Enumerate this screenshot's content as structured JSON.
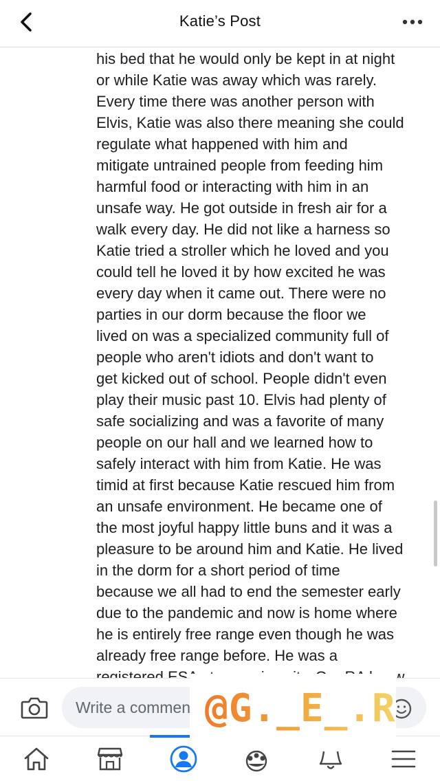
{
  "header": {
    "title": "Katie’s Post"
  },
  "post": {
    "lines": [
      "his bed that he would only be kept in at night",
      "or while Katie was away which was rarely.",
      "Every time there was another person with",
      "Elvis, Katie was also there meaning she could",
      "regulate what happened with him and",
      "mitigate untrained people from feeding him",
      "harmful food or interacting with him in an",
      "unsafe way. He got outside in fresh air for a",
      "walk every day. He did not like a harness so",
      "Katie tried a stroller which he loved and you",
      "could tell he loved it by how excited he was",
      "every day when it came out. There were no",
      "parties in our dorm because the floor we",
      "lived on was a specialized community full of",
      "people who aren't idiots and don't want to",
      "get kicked out of school. People didn't even",
      "play their music past 10. Elvis had plenty of",
      "safe socializing and was a favorite of many",
      "people on our hall and we learned how to",
      "safely interact with him from Katie. He was",
      "timid at first because Katie rescued him from",
      "an unsafe environment. He became one of",
      "the most joyful happy little buns and it was a",
      "pleasure to be around him and Katie. He lived",
      "in the dorm for a short period of time",
      "because we all had to end the semester early",
      "due to the pandemic and now is home where",
      "he is entirely free range even though he was",
      "already free range before. He was a",
      "registered ESA at our university. Our RA knew"
    ]
  },
  "comment_bar": {
    "placeholder": "Write a comment..."
  },
  "watermark": {
    "text": "@G._E_.R"
  },
  "tabs": [
    {
      "icon": "home-icon"
    },
    {
      "icon": "marketplace-icon"
    },
    {
      "icon": "profile-icon",
      "active": true
    },
    {
      "icon": "groups-icon"
    },
    {
      "icon": "notifications-icon"
    },
    {
      "icon": "menu-icon"
    }
  ],
  "colors": {
    "accent": "#1877f2",
    "text": "#1c1e21"
  }
}
